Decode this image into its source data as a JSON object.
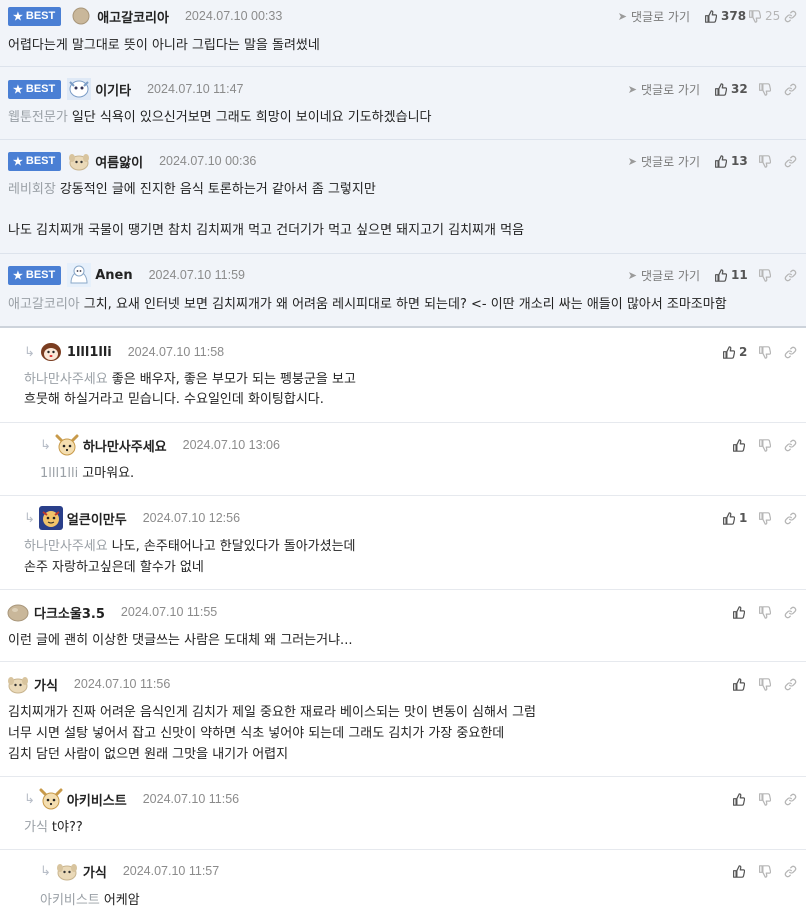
{
  "best_label": "BEST",
  "goto_label": "댓글로 가기",
  "comments": [
    {
      "nick": "애고갈코리아",
      "date": "2024.07.10 00:33",
      "likes": "378",
      "dislikes": "25",
      "mention": "",
      "lines": [
        "어렵다는게 말그대로 뜻이 아니라 그립다는 말을 돌려썼네"
      ]
    },
    {
      "nick": "이기타",
      "date": "2024.07.10 11:47",
      "likes": "32",
      "dislikes": "",
      "mention": "웹툰전문가",
      "lines": [
        "일단 식욕이 있으신거보면 그래도 희망이 보이네요 기도하겠습니다"
      ]
    },
    {
      "nick": "여름앓이",
      "date": "2024.07.10 00:36",
      "likes": "13",
      "dislikes": "",
      "mention": "레비회장",
      "lines": [
        "강동적인 글에 진지한 음식 토론하는거 같아서 좀 그렇지만",
        "나도 김치찌개 국물이 땡기면 참치 김치찌개 먹고 건더기가 먹고 싶으면 돼지고기 김치찌개 먹음"
      ]
    },
    {
      "nick": "Anen",
      "date": "2024.07.10 11:59",
      "likes": "11",
      "dislikes": "",
      "mention": "애고갈코리아",
      "lines": [
        "그치, 요새 인터넷 보면 김치찌개가 왜 어려움 레시피대로 하면 되는데? <- 이딴 개소리 싸는 애들이 많아서 조마조마함"
      ]
    },
    {
      "nick": "1lll1lli",
      "date": "2024.07.10 11:58",
      "likes": "2",
      "dislikes": "",
      "mention": "하나만사주세요",
      "lines": [
        "좋은 배우자, 좋은 부모가 되는 펭붕군을 보고",
        "흐뭇해 하실거라고 믿습니다. 수요일인데 화이팅합시다."
      ]
    },
    {
      "nick": "하나만사주세요",
      "date": "2024.07.10 13:06",
      "likes": "",
      "dislikes": "",
      "mention": "1lll1lli",
      "lines": [
        "고마워요."
      ]
    },
    {
      "nick": "얼큰이만두",
      "date": "2024.07.10 12:56",
      "likes": "1",
      "dislikes": "",
      "mention": "하나만사주세요",
      "lines": [
        "나도, 손주태어나고 한달있다가 돌아가셨는데",
        "손주 자랑하고싶은데 할수가 없네"
      ]
    },
    {
      "nick": "다크소울3.5",
      "date": "2024.07.10 11:55",
      "likes": "",
      "dislikes": "",
      "mention": "",
      "lines": [
        "이런 글에 괜히 이상한 댓글쓰는 사람은 도대체 왜 그러는거냐..."
      ]
    },
    {
      "nick": "가식",
      "date": "2024.07.10 11:56",
      "likes": "",
      "dislikes": "",
      "mention": "",
      "lines": [
        "김치찌개가 진짜 어려운 음식인게 김치가 제일 중요한 재료라 베이스되는 맛이 변동이 심해서 그럼",
        "너무 시면 설탕 넣어서 잡고 신맛이 약하면 식초 넣어야 되는데 그래도 김치가 가장 중요한데",
        "김치 담던 사람이 없으면 원래 그맛을 내기가 어렵지"
      ]
    },
    {
      "nick": "아키비스트",
      "date": "2024.07.10 11:56",
      "likes": "",
      "dislikes": "",
      "mention": "가식",
      "lines": [
        "t야??"
      ]
    },
    {
      "nick": "가식",
      "date": "2024.07.10 11:57",
      "likes": "",
      "dislikes": "",
      "mention": "아키비스트",
      "lines": [
        "어케암"
      ]
    }
  ]
}
